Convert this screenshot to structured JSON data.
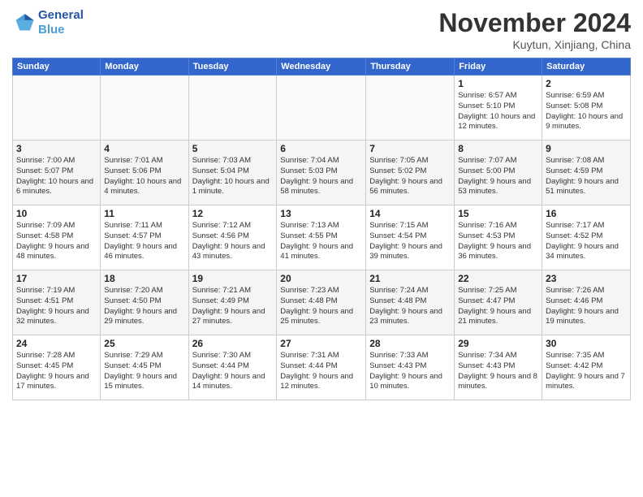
{
  "logo": {
    "line1": "General",
    "line2": "Blue"
  },
  "title": "November 2024",
  "subtitle": "Kuytun, Xinjiang, China",
  "weekdays": [
    "Sunday",
    "Monday",
    "Tuesday",
    "Wednesday",
    "Thursday",
    "Friday",
    "Saturday"
  ],
  "weeks": [
    [
      {
        "day": "",
        "info": ""
      },
      {
        "day": "",
        "info": ""
      },
      {
        "day": "",
        "info": ""
      },
      {
        "day": "",
        "info": ""
      },
      {
        "day": "",
        "info": ""
      },
      {
        "day": "1",
        "info": "Sunrise: 6:57 AM\nSunset: 5:10 PM\nDaylight: 10 hours and 12 minutes."
      },
      {
        "day": "2",
        "info": "Sunrise: 6:59 AM\nSunset: 5:08 PM\nDaylight: 10 hours and 9 minutes."
      }
    ],
    [
      {
        "day": "3",
        "info": "Sunrise: 7:00 AM\nSunset: 5:07 PM\nDaylight: 10 hours and 6 minutes."
      },
      {
        "day": "4",
        "info": "Sunrise: 7:01 AM\nSunset: 5:06 PM\nDaylight: 10 hours and 4 minutes."
      },
      {
        "day": "5",
        "info": "Sunrise: 7:03 AM\nSunset: 5:04 PM\nDaylight: 10 hours and 1 minute."
      },
      {
        "day": "6",
        "info": "Sunrise: 7:04 AM\nSunset: 5:03 PM\nDaylight: 9 hours and 58 minutes."
      },
      {
        "day": "7",
        "info": "Sunrise: 7:05 AM\nSunset: 5:02 PM\nDaylight: 9 hours and 56 minutes."
      },
      {
        "day": "8",
        "info": "Sunrise: 7:07 AM\nSunset: 5:00 PM\nDaylight: 9 hours and 53 minutes."
      },
      {
        "day": "9",
        "info": "Sunrise: 7:08 AM\nSunset: 4:59 PM\nDaylight: 9 hours and 51 minutes."
      }
    ],
    [
      {
        "day": "10",
        "info": "Sunrise: 7:09 AM\nSunset: 4:58 PM\nDaylight: 9 hours and 48 minutes."
      },
      {
        "day": "11",
        "info": "Sunrise: 7:11 AM\nSunset: 4:57 PM\nDaylight: 9 hours and 46 minutes."
      },
      {
        "day": "12",
        "info": "Sunrise: 7:12 AM\nSunset: 4:56 PM\nDaylight: 9 hours and 43 minutes."
      },
      {
        "day": "13",
        "info": "Sunrise: 7:13 AM\nSunset: 4:55 PM\nDaylight: 9 hours and 41 minutes."
      },
      {
        "day": "14",
        "info": "Sunrise: 7:15 AM\nSunset: 4:54 PM\nDaylight: 9 hours and 39 minutes."
      },
      {
        "day": "15",
        "info": "Sunrise: 7:16 AM\nSunset: 4:53 PM\nDaylight: 9 hours and 36 minutes."
      },
      {
        "day": "16",
        "info": "Sunrise: 7:17 AM\nSunset: 4:52 PM\nDaylight: 9 hours and 34 minutes."
      }
    ],
    [
      {
        "day": "17",
        "info": "Sunrise: 7:19 AM\nSunset: 4:51 PM\nDaylight: 9 hours and 32 minutes."
      },
      {
        "day": "18",
        "info": "Sunrise: 7:20 AM\nSunset: 4:50 PM\nDaylight: 9 hours and 29 minutes."
      },
      {
        "day": "19",
        "info": "Sunrise: 7:21 AM\nSunset: 4:49 PM\nDaylight: 9 hours and 27 minutes."
      },
      {
        "day": "20",
        "info": "Sunrise: 7:23 AM\nSunset: 4:48 PM\nDaylight: 9 hours and 25 minutes."
      },
      {
        "day": "21",
        "info": "Sunrise: 7:24 AM\nSunset: 4:48 PM\nDaylight: 9 hours and 23 minutes."
      },
      {
        "day": "22",
        "info": "Sunrise: 7:25 AM\nSunset: 4:47 PM\nDaylight: 9 hours and 21 minutes."
      },
      {
        "day": "23",
        "info": "Sunrise: 7:26 AM\nSunset: 4:46 PM\nDaylight: 9 hours and 19 minutes."
      }
    ],
    [
      {
        "day": "24",
        "info": "Sunrise: 7:28 AM\nSunset: 4:45 PM\nDaylight: 9 hours and 17 minutes."
      },
      {
        "day": "25",
        "info": "Sunrise: 7:29 AM\nSunset: 4:45 PM\nDaylight: 9 hours and 15 minutes."
      },
      {
        "day": "26",
        "info": "Sunrise: 7:30 AM\nSunset: 4:44 PM\nDaylight: 9 hours and 14 minutes."
      },
      {
        "day": "27",
        "info": "Sunrise: 7:31 AM\nSunset: 4:44 PM\nDaylight: 9 hours and 12 minutes."
      },
      {
        "day": "28",
        "info": "Sunrise: 7:33 AM\nSunset: 4:43 PM\nDaylight: 9 hours and 10 minutes."
      },
      {
        "day": "29",
        "info": "Sunrise: 7:34 AM\nSunset: 4:43 PM\nDaylight: 9 hours and 8 minutes."
      },
      {
        "day": "30",
        "info": "Sunrise: 7:35 AM\nSunset: 4:42 PM\nDaylight: 9 hours and 7 minutes."
      }
    ]
  ]
}
